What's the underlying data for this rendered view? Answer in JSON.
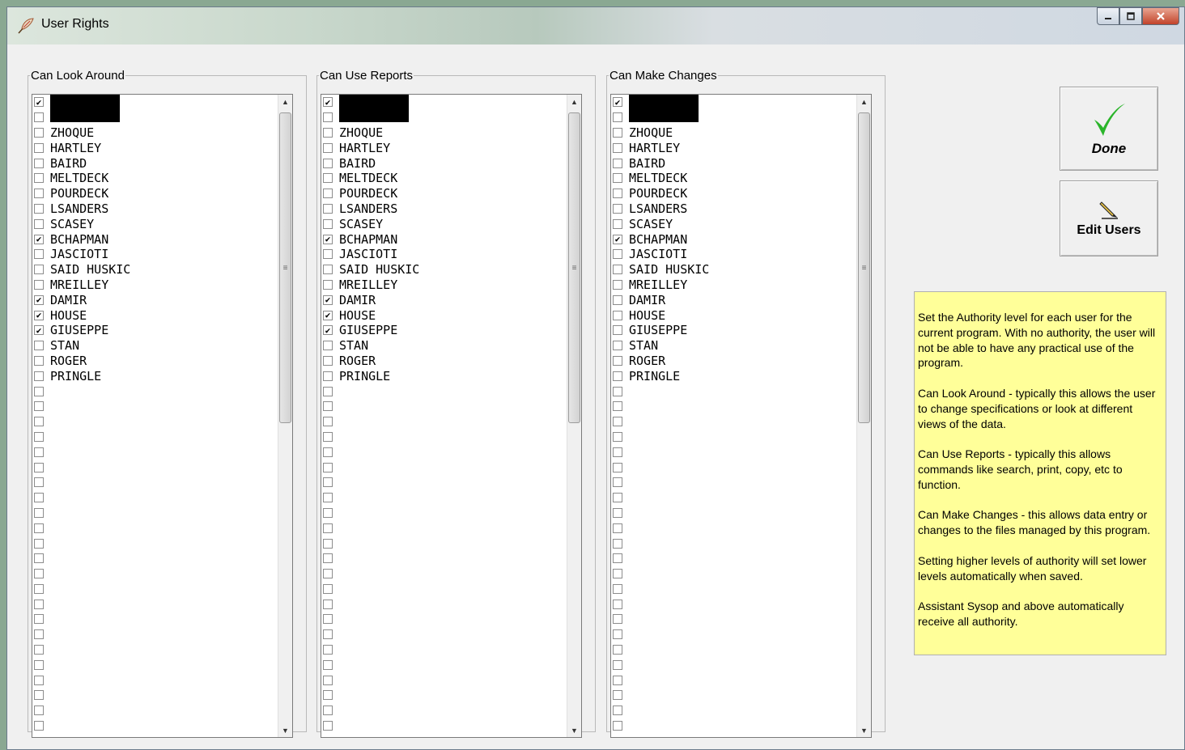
{
  "window": {
    "title": "User Rights"
  },
  "groups": [
    {
      "legend": "Can Look Around",
      "items": [
        {
          "label": "",
          "checked": true,
          "redacted": true
        },
        {
          "label": "",
          "checked": false,
          "redacted": true
        },
        {
          "label": "ZHOQUE",
          "checked": false
        },
        {
          "label": "HARTLEY",
          "checked": false
        },
        {
          "label": "BAIRD",
          "checked": false
        },
        {
          "label": "MELTDECK",
          "checked": false
        },
        {
          "label": "POURDECK",
          "checked": false
        },
        {
          "label": "LSANDERS",
          "checked": false
        },
        {
          "label": "SCASEY",
          "checked": false
        },
        {
          "label": "BCHAPMAN",
          "checked": true
        },
        {
          "label": "JASCIOTI",
          "checked": false
        },
        {
          "label": "SAID HUSKIC",
          "checked": false
        },
        {
          "label": "MREILLEY",
          "checked": false
        },
        {
          "label": "DAMIR",
          "checked": true
        },
        {
          "label": "HOUSE",
          "checked": true
        },
        {
          "label": "GIUSEPPE",
          "checked": true
        },
        {
          "label": "STAN",
          "checked": false
        },
        {
          "label": "ROGER",
          "checked": false
        },
        {
          "label": "PRINGLE",
          "checked": false
        }
      ]
    },
    {
      "legend": "Can Use Reports",
      "items": [
        {
          "label": "",
          "checked": true,
          "redacted": true
        },
        {
          "label": "",
          "checked": false,
          "redacted": true
        },
        {
          "label": "ZHOQUE",
          "checked": false
        },
        {
          "label": "HARTLEY",
          "checked": false
        },
        {
          "label": "BAIRD",
          "checked": false
        },
        {
          "label": "MELTDECK",
          "checked": false
        },
        {
          "label": "POURDECK",
          "checked": false
        },
        {
          "label": "LSANDERS",
          "checked": false
        },
        {
          "label": "SCASEY",
          "checked": false
        },
        {
          "label": "BCHAPMAN",
          "checked": true
        },
        {
          "label": "JASCIOTI",
          "checked": false
        },
        {
          "label": "SAID HUSKIC",
          "checked": false
        },
        {
          "label": "MREILLEY",
          "checked": false
        },
        {
          "label": "DAMIR",
          "checked": true
        },
        {
          "label": "HOUSE",
          "checked": true
        },
        {
          "label": "GIUSEPPE",
          "checked": true
        },
        {
          "label": "STAN",
          "checked": false
        },
        {
          "label": "ROGER",
          "checked": false
        },
        {
          "label": "PRINGLE",
          "checked": false
        }
      ]
    },
    {
      "legend": "Can Make Changes",
      "items": [
        {
          "label": "",
          "checked": true,
          "redacted": true
        },
        {
          "label": "",
          "checked": false,
          "redacted": true
        },
        {
          "label": "ZHOQUE",
          "checked": false
        },
        {
          "label": "HARTLEY",
          "checked": false
        },
        {
          "label": "BAIRD",
          "checked": false
        },
        {
          "label": "MELTDECK",
          "checked": false
        },
        {
          "label": "POURDECK",
          "checked": false
        },
        {
          "label": "LSANDERS",
          "checked": false
        },
        {
          "label": "SCASEY",
          "checked": false
        },
        {
          "label": "BCHAPMAN",
          "checked": true
        },
        {
          "label": "JASCIOTI",
          "checked": false
        },
        {
          "label": "SAID HUSKIC",
          "checked": false
        },
        {
          "label": "MREILLEY",
          "checked": false
        },
        {
          "label": "DAMIR",
          "checked": false
        },
        {
          "label": "HOUSE",
          "checked": false
        },
        {
          "label": "GIUSEPPE",
          "checked": false
        },
        {
          "label": "STAN",
          "checked": false
        },
        {
          "label": "ROGER",
          "checked": false
        },
        {
          "label": "PRINGLE",
          "checked": false
        }
      ]
    }
  ],
  "empty_rows_per_list": 23,
  "buttons": {
    "done_label": "Done",
    "done_icon": "checkmark-icon",
    "edit_label": "Edit Users",
    "edit_icon": "pencil-icon"
  },
  "help": {
    "paragraphs": [
      "Set the Authority level for each user for the current program. With no authority, the user will not be able to have any practical use of the program.",
      "Can Look Around - typically this allows the user to change specifications or look at different views of the data.",
      "Can Use Reports - typically this allows commands like search, print, copy, etc to function.",
      "Can Make Changes - this allows data entry or changes to the files managed by this program.",
      "Setting higher levels of authority will set lower levels automatically when saved.",
      "Assistant Sysop and above automatically receive all authority."
    ]
  },
  "colors": {
    "help_background": "#ffff99",
    "done_check": "#2bb52b"
  }
}
